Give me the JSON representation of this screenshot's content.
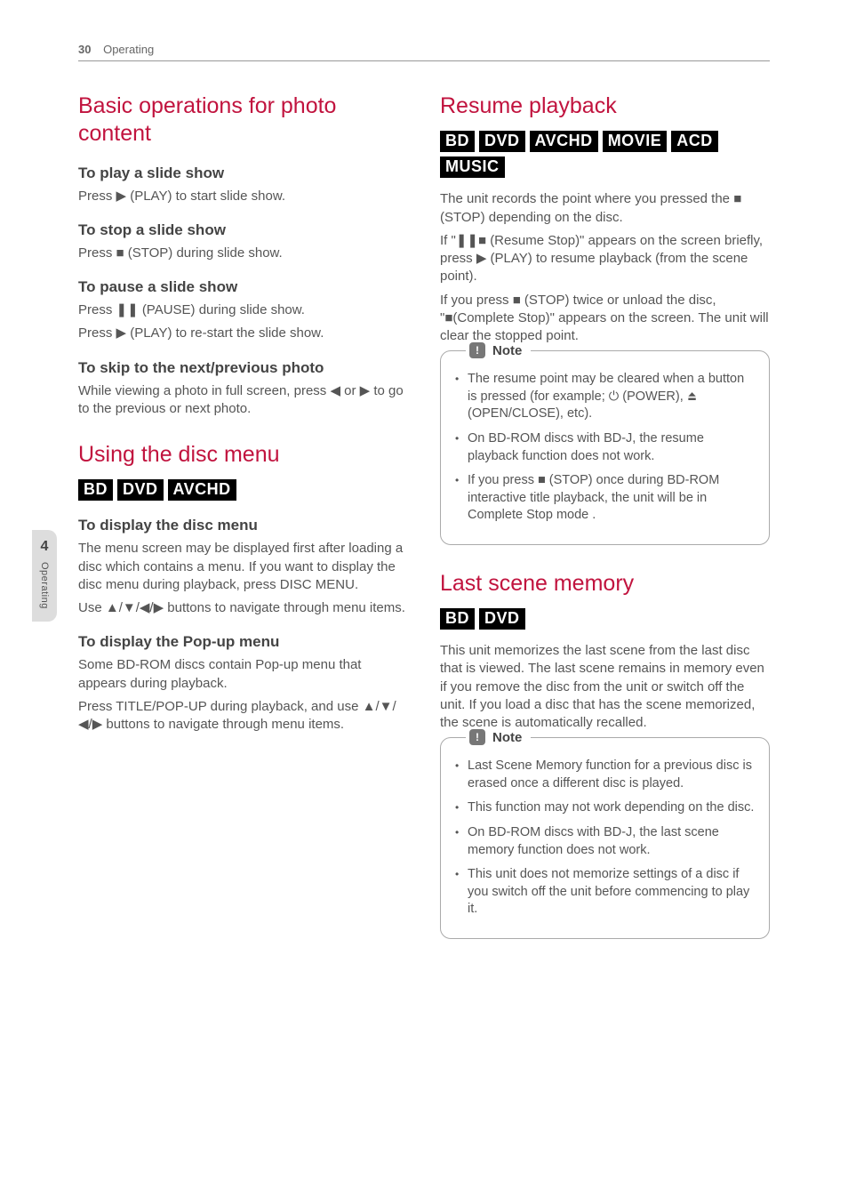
{
  "header": {
    "page_number": "30",
    "section": "Operating"
  },
  "side_tab": {
    "chapter": "4",
    "label": "Operating"
  },
  "left": {
    "basic_ops": {
      "title": "Basic operations for photo content",
      "play": {
        "heading": "To play a slide show",
        "text": "Press ▶ (PLAY) to start slide show."
      },
      "stop": {
        "heading": "To stop a slide show",
        "text": "Press ■ (STOP) during slide show."
      },
      "pause": {
        "heading": "To pause a slide show",
        "text1": "Press ❚❚ (PAUSE) during slide show.",
        "text2": "Press ▶ (PLAY) to re-start the slide show."
      },
      "skip": {
        "heading": "To skip to the next/previous photo",
        "text": "While viewing a photo in full screen, press ◀ or ▶ to go to the previous or next photo."
      }
    },
    "disc_menu": {
      "title": "Using the disc menu",
      "badges": [
        "BD",
        "DVD",
        "AVCHD"
      ],
      "display": {
        "heading": "To display the disc menu",
        "text1": "The menu screen may be displayed first after loading a disc which contains a menu. If you want to display the disc menu during playback, press DISC MENU.",
        "text2": "Use ▲/▼/◀/▶ buttons to navigate through menu items."
      },
      "popup": {
        "heading": "To display the Pop-up menu",
        "text1": "Some BD-ROM discs contain Pop-up menu that appears during playback.",
        "text2": "Press TITLE/POP-UP during playback, and use ▲/▼/◀/▶ buttons to navigate through menu items."
      }
    }
  },
  "right": {
    "resume": {
      "title": "Resume playback",
      "badges": [
        "BD",
        "DVD",
        "AVCHD",
        "MOVIE",
        "ACD",
        "MUSIC"
      ],
      "text1": "The unit records the point where you pressed the ■ (STOP) depending on the disc.",
      "text2": "If \"❚❚■ (Resume Stop)\" appears on the screen briefly, press ▶ (PLAY) to resume playback (from the scene point).",
      "text3": "If you press ■ (STOP) twice or unload the disc, \"■(Complete Stop)\" appears on the screen. The unit will clear the stopped point.",
      "note_label": "Note",
      "notes": [
        "The resume point may be cleared when a button is pressed (for example; ⏻ (POWER), ⏏ (OPEN/CLOSE), etc).",
        "On BD-ROM discs with BD-J, the resume playback function does not work.",
        "If you press ■ (STOP) once during BD-ROM interactive title playback, the unit will be in Complete Stop mode ."
      ]
    },
    "last_scene": {
      "title": "Last scene memory",
      "badges": [
        "BD",
        "DVD"
      ],
      "text": "This unit memorizes the last scene from the last disc that is viewed. The last scene remains in memory even if you remove the disc from the unit or switch off the unit. If you load a disc that has the scene memorized, the scene is automatically recalled.",
      "note_label": "Note",
      "notes": [
        "Last Scene Memory function for a previous disc is erased once a different disc is played.",
        "This function may not work depending on the disc.",
        "On BD-ROM discs with BD-J, the last scene memory function does not work.",
        "This unit does not memorize settings of a disc if you switch off the unit before commencing to play it."
      ]
    }
  }
}
